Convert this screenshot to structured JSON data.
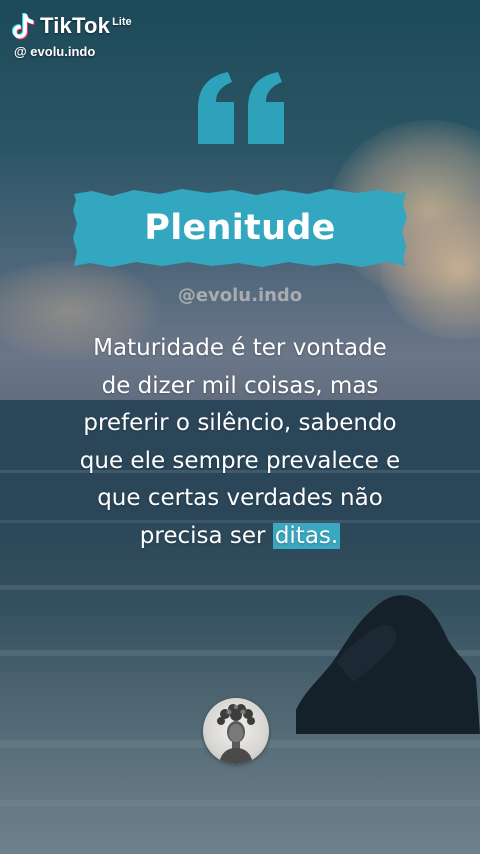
{
  "app": {
    "name": "TikTok",
    "variant": "Lite",
    "handle": "@ evolu.indo",
    "icon": "tiktok-note-icon"
  },
  "post": {
    "title": "Plenitude",
    "watermark": "@evolu.indo",
    "quote_lines": [
      "Maturidade é ter vontade",
      "de dizer mil coisas, mas",
      "preferir o silêncio, sabendo",
      "que ele sempre prevalece e",
      "que certas verdades não"
    ],
    "last_line_prefix": "precisa ser ",
    "last_line_highlight": "ditas.",
    "quote_icon": "quotation-mark-icon",
    "avatar_icon": "creator-avatar-icon"
  },
  "colors": {
    "accent": "#3aa8c0",
    "text": "#ffffff"
  }
}
